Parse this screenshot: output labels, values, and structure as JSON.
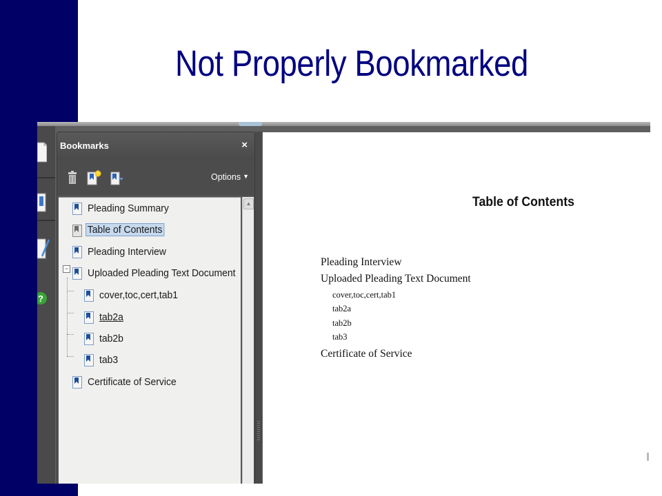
{
  "slide": {
    "title": "Not Properly Bookmarked",
    "accent_color": "#000066",
    "title_color": "#000080"
  },
  "bookmarks_panel": {
    "title": "Bookmarks",
    "close_glyph": "×",
    "options_label": "Options",
    "toolbar_icons": [
      "delete-bookmark-icon",
      "new-bookmark-icon",
      "expand-bookmark-icon"
    ],
    "items": [
      {
        "label": "Pleading Summary",
        "level": 0,
        "icon": "bookmark-icon"
      },
      {
        "label": "Table of Contents",
        "level": 0,
        "icon": "bookmark-icon",
        "selected": true
      },
      {
        "label": "Pleading Interview",
        "level": 0,
        "icon": "bookmark-icon"
      },
      {
        "label": "Uploaded Pleading Text Document",
        "level": 0,
        "icon": "bookmark-icon",
        "expanded": true
      },
      {
        "label": "cover,toc,cert,tab1",
        "level": 1,
        "icon": "bookmark-icon"
      },
      {
        "label": "tab2a",
        "level": 1,
        "icon": "bookmark-icon",
        "hovered": true
      },
      {
        "label": "tab2b",
        "level": 1,
        "icon": "bookmark-icon"
      },
      {
        "label": "tab3",
        "level": 1,
        "icon": "bookmark-icon"
      },
      {
        "label": "Certificate of Service",
        "level": 0,
        "icon": "bookmark-icon"
      }
    ]
  },
  "side_tools": [
    "pages-icon",
    "attachments-icon",
    "signatures-icon",
    "help-icon"
  ],
  "document": {
    "heading": "Table of Contents",
    "toc": [
      {
        "text": "Pleading Interview",
        "level": 1
      },
      {
        "text": "Uploaded Pleading Text Document",
        "level": 1
      },
      {
        "text": "cover,toc,cert,tab1",
        "level": 2
      },
      {
        "text": "tab2a",
        "level": 2
      },
      {
        "text": "tab2b",
        "level": 2
      },
      {
        "text": "tab3",
        "level": 2
      },
      {
        "text": "Certificate of Service",
        "level": 1
      }
    ]
  }
}
